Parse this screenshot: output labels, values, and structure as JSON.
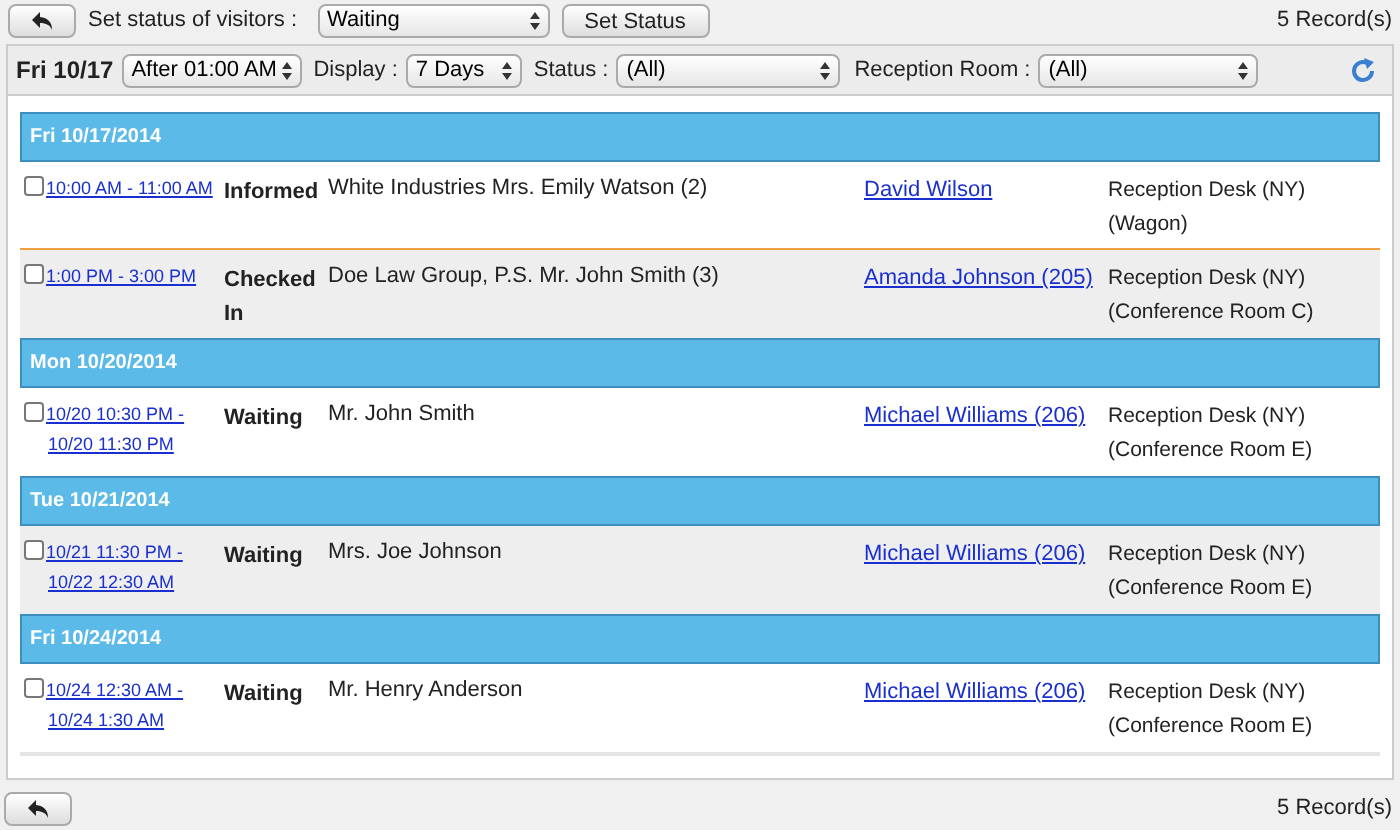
{
  "top_bar": {
    "status_label": "Set status of visitors :",
    "status_value": "Waiting",
    "set_button": "Set Status",
    "record_count": "5 Record(s)"
  },
  "filter_bar": {
    "date": "Fri 10/17",
    "time_value": "After 01:00 AM",
    "display_label": "Display :",
    "display_value": "7 Days",
    "status_label": "Status :",
    "status_value": "(All)",
    "room_label": "Reception Room :",
    "room_value": "(All)"
  },
  "groups": [
    {
      "date": "Fri 10/17/2014",
      "visits": [
        {
          "checked": false,
          "time": [
            "10:00 AM - 11:00 AM"
          ],
          "status": "Informed",
          "visitor": "White Industries Mrs. Emily Watson (2)",
          "host": "David Wilson",
          "room": [
            "Reception Desk (NY)",
            "(Wagon)"
          ],
          "now_marker": true
        },
        {
          "checked": false,
          "time": [
            "1:00 PM - 3:00 PM"
          ],
          "status": "Checked In",
          "visitor": "Doe Law Group, P.S. Mr. John Smith (3)",
          "host": "Amanda Johnson (205)",
          "room": [
            "Reception Desk (NY)",
            "(Conference Room C)"
          ],
          "now_marker": false
        }
      ]
    },
    {
      "date": "Mon 10/20/2014",
      "visits": [
        {
          "checked": false,
          "time": [
            "10/20 10:30 PM -",
            "10/20 11:30 PM"
          ],
          "status": "Waiting",
          "visitor": "Mr. John Smith",
          "host": "Michael Williams (206)",
          "room": [
            "Reception Desk (NY)",
            "(Conference Room E)"
          ],
          "now_marker": false
        }
      ]
    },
    {
      "date": "Tue 10/21/2014",
      "visits": [
        {
          "checked": false,
          "time": [
            "10/21 11:30 PM -",
            "10/22 12:30 AM"
          ],
          "status": "Waiting",
          "visitor": "Mrs. Joe Johnson",
          "host": "Michael Williams (206)",
          "room": [
            "Reception Desk (NY)",
            "(Conference Room E)"
          ],
          "now_marker": false
        }
      ]
    },
    {
      "date": "Fri 10/24/2014",
      "visits": [
        {
          "checked": false,
          "time": [
            "10/24 12:30 AM -",
            "10/24 1:30 AM"
          ],
          "status": "Waiting",
          "visitor": "Mr. Henry Anderson",
          "host": "Michael Williams (206)",
          "room": [
            "Reception Desk (NY)",
            "(Conference Room E)"
          ],
          "now_marker": false
        }
      ]
    }
  ],
  "bottom_bar": {
    "record_count": "5 Record(s)"
  }
}
